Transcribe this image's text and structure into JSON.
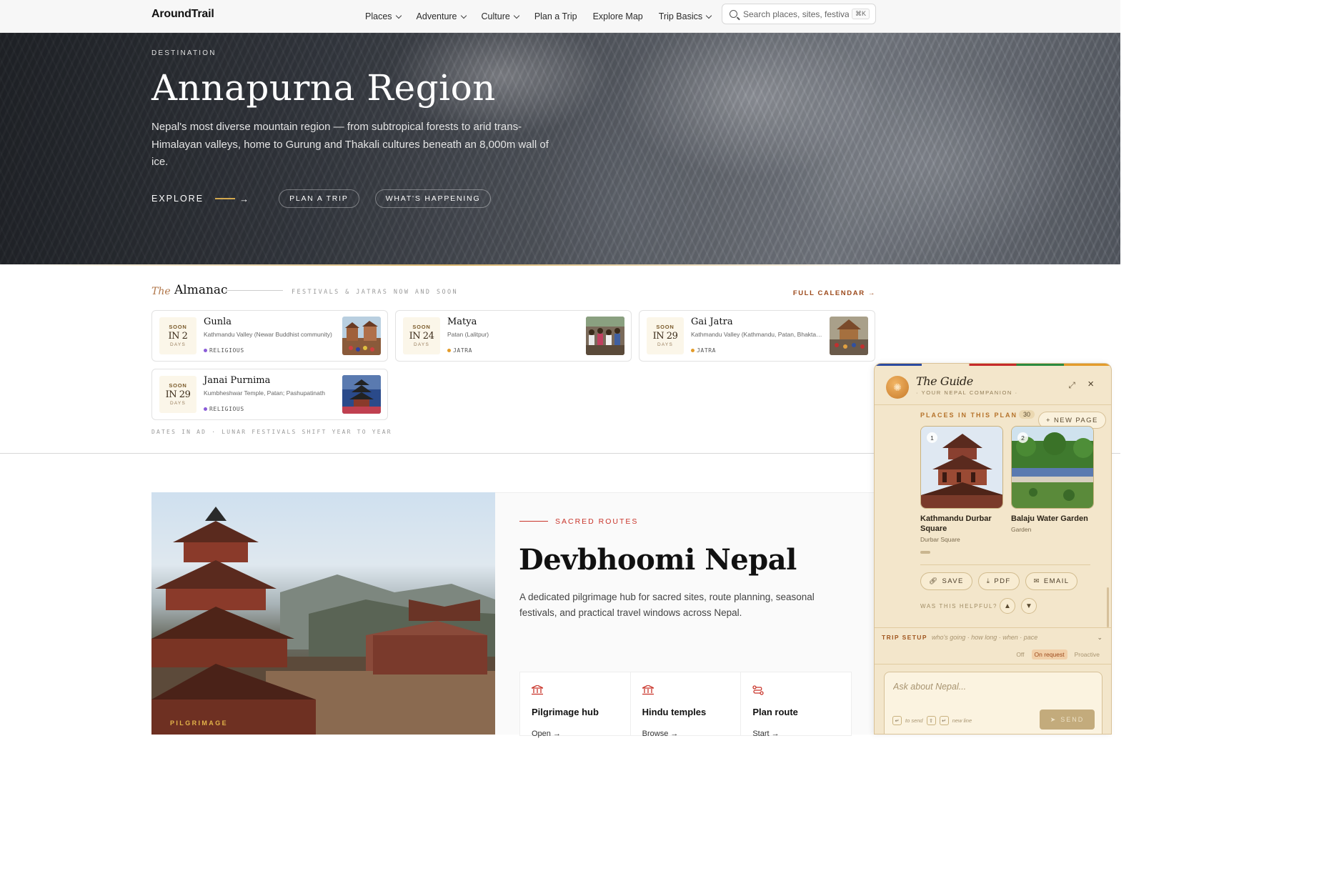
{
  "header": {
    "brand": "AroundTrail",
    "nav": [
      {
        "label": "Places",
        "dropdown": true
      },
      {
        "label": "Adventure",
        "dropdown": true
      },
      {
        "label": "Culture",
        "dropdown": true
      },
      {
        "label": "Plan a Trip",
        "dropdown": false
      },
      {
        "label": "Explore Map",
        "dropdown": false
      },
      {
        "label": "Trip Basics",
        "dropdown": true
      }
    ],
    "search_placeholder": "Search places, sites, festivals",
    "search_shortcut": "⌘K"
  },
  "hero": {
    "eyebrow": "DESTINATION",
    "title": "Annapurna Region",
    "subtitle": "Nepal's most diverse mountain region — from subtropical forests to arid trans-Himalayan valleys, home to Gurung and Thakali cultures beneath an 8,000m wall of ice.",
    "explore_label": "EXPLORE",
    "plan_label": "PLAN A TRIP",
    "happening_label": "WHAT'S HAPPENING"
  },
  "almanac": {
    "the": "The",
    "title": "Almanac",
    "subtitle": "FESTIVALS & JATRAS NOW AND SOON",
    "calendar_link": "FULL CALENDAR →",
    "footnote": "DATES IN AD · LUNAR FESTIVALS SHIFT YEAR TO YEAR",
    "festivals": [
      {
        "soon": "SOON",
        "in": "IN 2",
        "days": "DAYS",
        "name": "Gunla",
        "place": "Kathmandu Valley (Newar Buddhist community)",
        "tag": "RELIGIOUS",
        "tag_color": "#8a5cd8"
      },
      {
        "soon": "SOON",
        "in": "IN 24",
        "days": "DAYS",
        "name": "Matya",
        "place": "Patan (Lalitpur)",
        "tag": "JATRA",
        "tag_color": "#e39b2a"
      },
      {
        "soon": "SOON",
        "in": "IN 29",
        "days": "DAYS",
        "name": "Gai Jatra",
        "place": "Kathmandu Valley (Kathmandu, Patan, Bhaktapur)",
        "tag": "JATRA",
        "tag_color": "#e39b2a"
      },
      {
        "soon": "SOON",
        "in": "IN 29",
        "days": "DAYS",
        "name": "Janai Purnima",
        "place": "Kumbheshwar Temple, Patan; Pashupatinath",
        "tag": "RELIGIOUS",
        "tag_color": "#8a5cd8"
      }
    ]
  },
  "devbhoomi": {
    "image_tag": "PILGRIMAGE",
    "eyebrow": "SACRED ROUTES",
    "title": "Devbhoomi Nepal",
    "description": "A dedicated pilgrimage hub for sacred sites, route planning, seasonal festivals, and practical travel windows across Nepal.",
    "cards": [
      {
        "icon": "temple-icon",
        "title": "Pilgrimage hub",
        "link": "Open →"
      },
      {
        "icon": "temple-icon",
        "title": "Hindu temples",
        "link": "Browse →"
      },
      {
        "icon": "route-icon",
        "title": "Plan route",
        "link": "Start →"
      }
    ]
  },
  "guide": {
    "title": "The Guide",
    "subtitle": "· YOUR NEPAL COMPANION ·",
    "places_label": "PLACES IN THIS PLAN",
    "places_count": "30",
    "new_page": "+ NEW PAGE",
    "places": [
      {
        "num": "1",
        "name": "Kathmandu Durbar Square",
        "type": "Durbar Square"
      },
      {
        "num": "2",
        "name": "Balaju Water Garden",
        "type": "Garden"
      }
    ],
    "actions": [
      {
        "icon": "link-icon",
        "label": "SAVE"
      },
      {
        "icon": "download-icon",
        "label": "PDF"
      },
      {
        "icon": "mail-icon",
        "label": "EMAIL"
      }
    ],
    "helpful": "WAS THIS HELPFUL?",
    "trip_setup": "TRIP SETUP",
    "trip_hint": "who's going · how long · when · pace",
    "modes": [
      "Off",
      "On request",
      "Proactive"
    ],
    "mode_selected": "On request",
    "chat_placeholder": "Ask about Nepal...",
    "hint_send": "to send",
    "hint_newline": "new line",
    "send": "SEND"
  }
}
